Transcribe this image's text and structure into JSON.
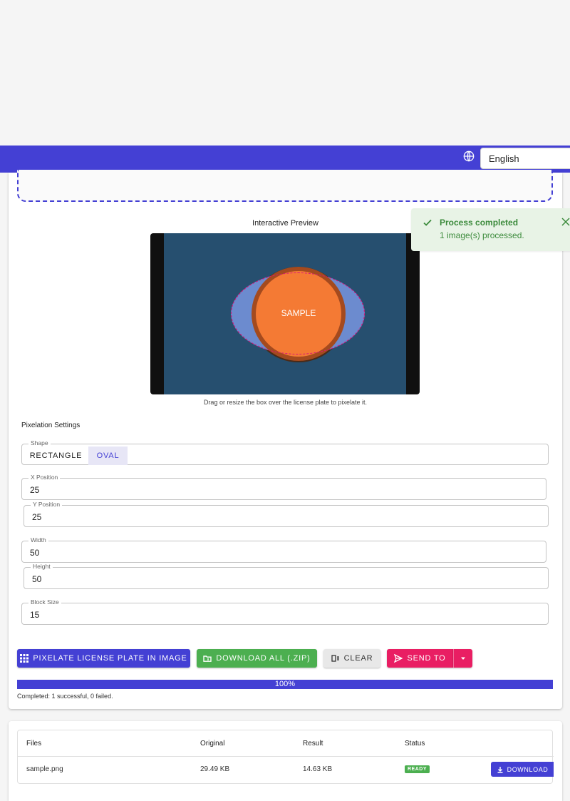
{
  "header": {
    "language": "English",
    "globe_icon": "globe-icon"
  },
  "toast": {
    "title": "Process completed",
    "message": "1 image(s) processed."
  },
  "preview": {
    "title": "Interactive Preview",
    "sample_label": "SAMPLE",
    "hint": "Drag or resize the box over the license plate to pixelate it."
  },
  "settings": {
    "title": "Pixelation Settings",
    "shape": {
      "label": "Shape",
      "options": [
        "RECTANGLE",
        "OVAL"
      ],
      "selected": "OVAL"
    },
    "x": {
      "label": "X Position",
      "value": "25"
    },
    "y": {
      "label": "Y Position",
      "value": "25"
    },
    "width": {
      "label": "Width",
      "value": "50"
    },
    "height": {
      "label": "Height",
      "value": "50"
    },
    "block_size": {
      "label": "Block Size",
      "value": "15"
    }
  },
  "actions": {
    "pixelate": "PIXELATE LICENSE PLATE IN IMAGE",
    "download_all": "DOWNLOAD ALL (.ZIP)",
    "clear": "CLEAR",
    "send_to": "SEND TO"
  },
  "progress": {
    "percent_label": "100%",
    "value": 1.0,
    "summary": "Completed: 1 successful, 0 failed."
  },
  "files_table": {
    "headers": [
      "Files",
      "Original",
      "Result",
      "Status"
    ],
    "rows": [
      {
        "file": "sample.png",
        "original": "29.49 KB",
        "result": "14.63 KB",
        "status": "READY",
        "action": "DOWNLOAD"
      }
    ]
  },
  "colors": {
    "primary": "#4440d4",
    "success": "#4caf50",
    "accent": "#e91e63"
  }
}
